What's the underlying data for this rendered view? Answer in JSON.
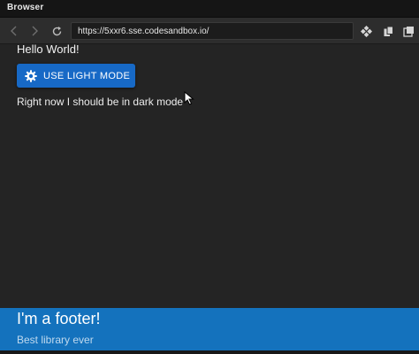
{
  "window": {
    "title": "Browser"
  },
  "toolbar": {
    "url": "https://5xxr6.sse.codesandbox.io/",
    "icons": [
      "back-arrow-icon",
      "forward-arrow-icon",
      "reload-icon",
      "extension-icon",
      "copy-icon",
      "new-window-icon"
    ]
  },
  "content": {
    "greeting": "Hello World!",
    "mode_button_label": "USE LIGHT MODE",
    "mode_button_icon": "gear-icon",
    "status_text": "Right now I should be in dark mode"
  },
  "footer": {
    "title": "I'm a footer!",
    "subtitle": "Best library ever"
  },
  "colors": {
    "background": "#242424",
    "toolbar": "#2d2d2d",
    "button": "#1769c6",
    "footer": "#1472bd"
  }
}
